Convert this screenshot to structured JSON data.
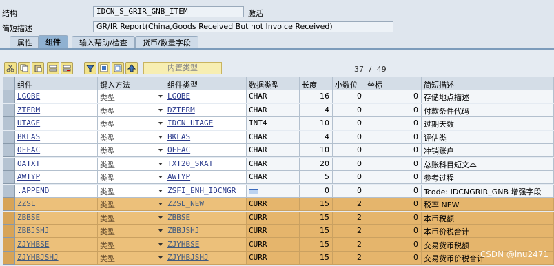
{
  "header": {
    "structure_label": "结构",
    "structure_value": "IDCN_S_GRIR_GNB_ITEM",
    "status": "激活",
    "desc_label": "简短描述",
    "desc_value": "GR/IR Report(China,Goods Received But not Invoice Received)"
  },
  "tabs": [
    {
      "label": "属性",
      "active": false
    },
    {
      "label": "组件",
      "active": true
    },
    {
      "label": "输入帮助/检查",
      "active": false
    },
    {
      "label": "货币/数量字段",
      "active": false
    }
  ],
  "toolbar": {
    "builtin_type_label": "内置类型",
    "icons": [
      "cut-icon",
      "copy-icon",
      "paste-icon",
      "insert-row-icon",
      "delete-row-icon",
      "filter-icon",
      "select-all-icon",
      "deselect-icon",
      "up-arrow-icon"
    ]
  },
  "counter": {
    "current": "37",
    "separator": "/",
    "total": "49"
  },
  "columns": [
    "组件",
    "键入方法",
    "组件类型",
    "数据类型",
    "长度",
    "小数位",
    "坐标",
    "简短描述"
  ],
  "rows": [
    {
      "comp": "LGOBE",
      "method": "类型",
      "ctype": "LGOBE",
      "dtype": "CHAR",
      "len": "16",
      "dec": "0",
      "coord": "0",
      "desc": "存储地点描述",
      "hl": false
    },
    {
      "comp": "ZTERM",
      "method": "类型",
      "ctype": "DZTERM",
      "dtype": "CHAR",
      "len": "4",
      "dec": "0",
      "coord": "0",
      "desc": "付款条件代码",
      "hl": false
    },
    {
      "comp": "UTAGE",
      "method": "类型",
      "ctype": "IDCN_UTAGE",
      "dtype": "INT4",
      "len": "10",
      "dec": "0",
      "coord": "0",
      "desc": "过期天数",
      "hl": false
    },
    {
      "comp": "BKLAS",
      "method": "类型",
      "ctype": "BKLAS",
      "dtype": "CHAR",
      "len": "4",
      "dec": "0",
      "coord": "0",
      "desc": "评估类",
      "hl": false
    },
    {
      "comp": "OFFAC",
      "method": "类型",
      "ctype": "OFFAC",
      "dtype": "CHAR",
      "len": "10",
      "dec": "0",
      "coord": "0",
      "desc": "冲销账户",
      "hl": false
    },
    {
      "comp": "OATXT",
      "method": "类型",
      "ctype": "TXT20_SKAT",
      "dtype": "CHAR",
      "len": "20",
      "dec": "0",
      "coord": "0",
      "desc": "总账科目短文本",
      "hl": false
    },
    {
      "comp": "AWTYP",
      "method": "类型",
      "ctype": "AWTYP",
      "dtype": "CHAR",
      "len": "5",
      "dec": "0",
      "coord": "0",
      "desc": "参考过程",
      "hl": false
    },
    {
      "comp": ".APPEND",
      "method": "类型",
      "ctype": "ZSFI_ENH_IDCNGR",
      "dtype": "",
      "len": "0",
      "dec": "0",
      "coord": "0",
      "desc": "Tcode: IDCNGRIR_GNB 增强字段",
      "hl": false,
      "append": true
    },
    {
      "comp": "ZZSL",
      "method": "类型",
      "ctype": "ZZSL_NEW",
      "dtype": "CURR",
      "len": "15",
      "dec": "2",
      "coord": "0",
      "desc": "税率 NEW",
      "hl": true
    },
    {
      "comp": "ZBBSE",
      "method": "类型",
      "ctype": "ZBBSE",
      "dtype": "CURR",
      "len": "15",
      "dec": "2",
      "coord": "0",
      "desc": "本币税额",
      "hl": true
    },
    {
      "comp": "ZBBJSHJ",
      "method": "类型",
      "ctype": "ZBBJSHJ",
      "dtype": "CURR",
      "len": "15",
      "dec": "2",
      "coord": "0",
      "desc": "本币价税合计",
      "hl": true
    },
    {
      "comp": "ZJYHBSE",
      "method": "类型",
      "ctype": "ZJYHBSE",
      "dtype": "CURR",
      "len": "15",
      "dec": "2",
      "coord": "0",
      "desc": "交易货币税额",
      "hl": true
    },
    {
      "comp": "ZJYHBJSHJ",
      "method": "类型",
      "ctype": "ZJYHBJSHJ",
      "dtype": "CURR",
      "len": "15",
      "dec": "2",
      "coord": "0",
      "desc": "交易货币价税合计",
      "hl": true
    }
  ],
  "watermark": "CSDN @lnu2471"
}
